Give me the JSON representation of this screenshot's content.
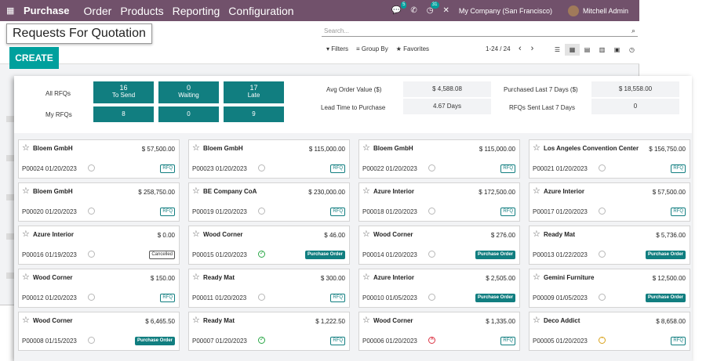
{
  "navbar": {
    "app_name": "Purchase",
    "menus": [
      "Order",
      "Products",
      "Reporting",
      "Configuration"
    ],
    "chat_badge": "5",
    "activity_badge": "31",
    "company": "My Company (San Francisco)",
    "user": "Mitchell Admin"
  },
  "control_panel": {
    "title": "Requests For Quotation",
    "create_label": "CREATE",
    "search_placeholder": "Search...",
    "filters_label": "Filters",
    "group_by_label": "Group By",
    "favorites_label": "Favorites",
    "pager": "1-24 / 24"
  },
  "dashboard": {
    "all_rfqs_label": "All RFQs",
    "my_rfqs_label": "My RFQs",
    "to_send": {
      "count": "16",
      "label": "To Send",
      "my": "8"
    },
    "waiting": {
      "count": "0",
      "label": "Waiting",
      "my": "0"
    },
    "late": {
      "count": "17",
      "label": "Late",
      "my": "9"
    },
    "avg_order_label": "Avg Order Value ($)",
    "avg_order_value": "$ 4,588.08",
    "lead_time_label": "Lead Time to Purchase",
    "lead_time_value": "4.67  Days",
    "purchased_label": "Purchased Last 7 Days ($)",
    "purchased_value": "$ 18,558.00",
    "rfqs_sent_label": "RFQs Sent Last 7 Days",
    "rfqs_sent_value": "0"
  },
  "cards": [
    {
      "partner": "Bloem GmbH",
      "amount": "$ 57,500.00",
      "ref": "P00024 01/20/2023",
      "activity": "none",
      "status": "RFQ",
      "kind": "rfq"
    },
    {
      "partner": "Bloem GmbH",
      "amount": "$ 115,000.00",
      "ref": "P00023 01/20/2023",
      "activity": "none",
      "status": "RFQ",
      "kind": "rfq"
    },
    {
      "partner": "Bloem GmbH",
      "amount": "$ 115,000.00",
      "ref": "P00022 01/20/2023",
      "activity": "none",
      "status": "RFQ",
      "kind": "rfq"
    },
    {
      "partner": "Los Angeles Convention Center",
      "amount": "$ 156,750.00",
      "ref": "P00021 01/20/2023",
      "activity": "none",
      "status": "RFQ",
      "kind": "rfq"
    },
    {
      "partner": "Bloem GmbH",
      "amount": "$ 258,750.00",
      "ref": "P00020 01/20/2023",
      "activity": "none",
      "status": "RFQ",
      "kind": "rfq"
    },
    {
      "partner": "BE Company CoA",
      "amount": "$ 230,000.00",
      "ref": "P00019 01/20/2023",
      "activity": "none",
      "status": "RFQ",
      "kind": "rfq"
    },
    {
      "partner": "Azure Interior",
      "amount": "$ 172,500.00",
      "ref": "P00018 01/20/2023",
      "activity": "none",
      "status": "RFQ",
      "kind": "rfq"
    },
    {
      "partner": "Azure Interior",
      "amount": "$ 57,500.00",
      "ref": "P00017 01/20/2023",
      "activity": "none",
      "status": "RFQ",
      "kind": "rfq"
    },
    {
      "partner": "Azure Interior",
      "amount": "$ 0.00",
      "ref": "P00016 01/19/2023",
      "activity": "none",
      "status": "Cancelled",
      "kind": "cancel"
    },
    {
      "partner": "Wood Corner",
      "amount": "$ 46.00",
      "ref": "P00015 01/20/2023",
      "activity": "ok",
      "status": "Purchase Order",
      "kind": "po"
    },
    {
      "partner": "Wood Corner",
      "amount": "$ 276.00",
      "ref": "P00014 01/20/2023",
      "activity": "none",
      "status": "Purchase Order",
      "kind": "po"
    },
    {
      "partner": "Ready Mat",
      "amount": "$ 5,736.00",
      "ref": "P00013 01/22/2023",
      "activity": "none",
      "status": "Purchase Order",
      "kind": "po"
    },
    {
      "partner": "Wood Corner",
      "amount": "$ 150.00",
      "ref": "P00012 01/20/2023",
      "activity": "none",
      "status": "RFQ",
      "kind": "rfq"
    },
    {
      "partner": "Ready Mat",
      "amount": "$ 300.00",
      "ref": "P00011 01/20/2023",
      "activity": "none",
      "status": "RFQ",
      "kind": "rfq"
    },
    {
      "partner": "Azure Interior",
      "amount": "$ 2,505.00",
      "ref": "P00010 01/05/2023",
      "activity": "none",
      "status": "Purchase Order",
      "kind": "po"
    },
    {
      "partner": "Gemini Furniture",
      "amount": "$ 12,500.00",
      "ref": "P00009 01/05/2023",
      "activity": "none",
      "status": "Purchase Order",
      "kind": "po"
    },
    {
      "partner": "Wood Corner",
      "amount": "$ 6,465.50",
      "ref": "P00008 01/15/2023",
      "activity": "none",
      "status": "Purchase Order",
      "kind": "po"
    },
    {
      "partner": "Ready Mat",
      "amount": "$ 1,222.50",
      "ref": "P00007 01/20/2023",
      "activity": "ok",
      "status": "RFQ",
      "kind": "rfq"
    },
    {
      "partner": "Wood Corner",
      "amount": "$ 1,335.00",
      "ref": "P00006 01/20/2023",
      "activity": "late",
      "status": "RFQ",
      "kind": "rfq"
    },
    {
      "partner": "Deco Addict",
      "amount": "$ 8,658.00",
      "ref": "P00005 01/20/2023",
      "activity": "warn",
      "status": "RFQ",
      "kind": "rfq"
    }
  ]
}
